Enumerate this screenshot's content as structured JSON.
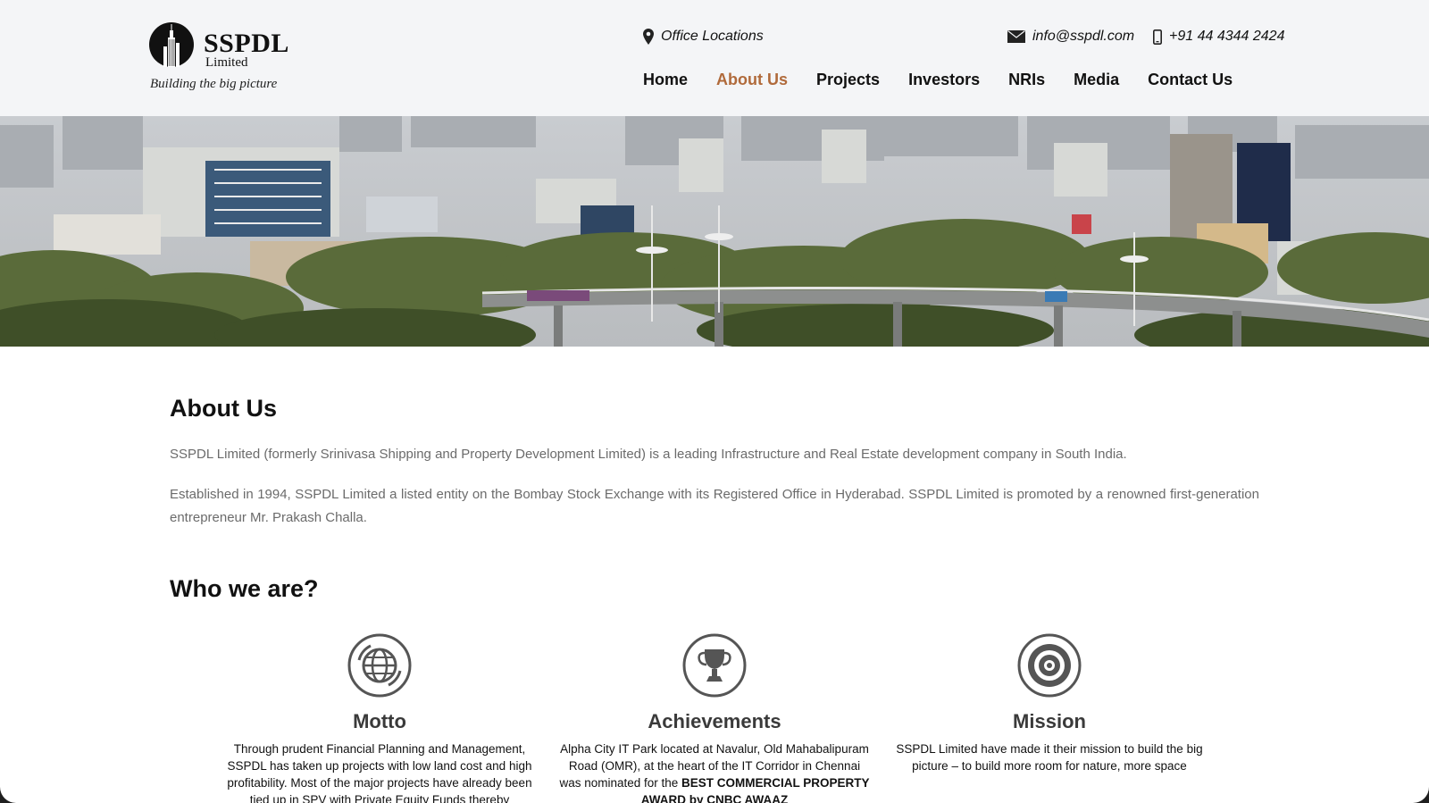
{
  "header": {
    "logo": {
      "name": "SSPDL",
      "sub": "Limited",
      "tagline": "Building the big picture"
    },
    "office_locations": "Office Locations",
    "email": "info@sspdl.com",
    "phone": "+91 44 4344 2424",
    "nav": [
      {
        "label": "Home",
        "active": false
      },
      {
        "label": "About Us",
        "active": true
      },
      {
        "label": "Projects",
        "active": false
      },
      {
        "label": "Investors",
        "active": false
      },
      {
        "label": "NRIs",
        "active": false
      },
      {
        "label": "Media",
        "active": false
      },
      {
        "label": "Contact Us",
        "active": false
      }
    ]
  },
  "about": {
    "title": "About Us",
    "p1": "SSPDL Limited (formerly Srinivasa Shipping and Property Development Limited) is a leading Infrastructure and Real Estate development company in South India.",
    "p2": "Established in 1994, SSPDL Limited a listed entity on the Bombay Stock Exchange with its Registered Office in Hyderabad. SSPDL Limited is promoted by a renowned first-generation entrepreneur Mr. Prakash Challa."
  },
  "who": {
    "title": "Who we are?",
    "cards": [
      {
        "icon": "globe-icon",
        "title": "Motto",
        "text": "Through prudent Financial Planning and Management, SSPDL has taken up projects with low land cost and high profitability. Most of the major projects have already been tied up in SPV with Private Equity Funds thereby"
      },
      {
        "icon": "trophy-icon",
        "title": "Achievements",
        "text": "Alpha City IT Park located at Navalur, Old Mahabalipuram Road (OMR), at the heart of the IT Corridor in Chennai was nominated for the ",
        "bold": "BEST COMMERCIAL PROPERTY AWARD by CNBC AWAAZ"
      },
      {
        "icon": "target-icon",
        "title": "Mission",
        "text": "SSPDL Limited have made it their mission to build the big picture – to build more room for nature, more space"
      }
    ]
  },
  "colors": {
    "accent": "#b06a3b",
    "header_bg": "#f4f5f7",
    "text_muted": "#6b6b6b"
  }
}
